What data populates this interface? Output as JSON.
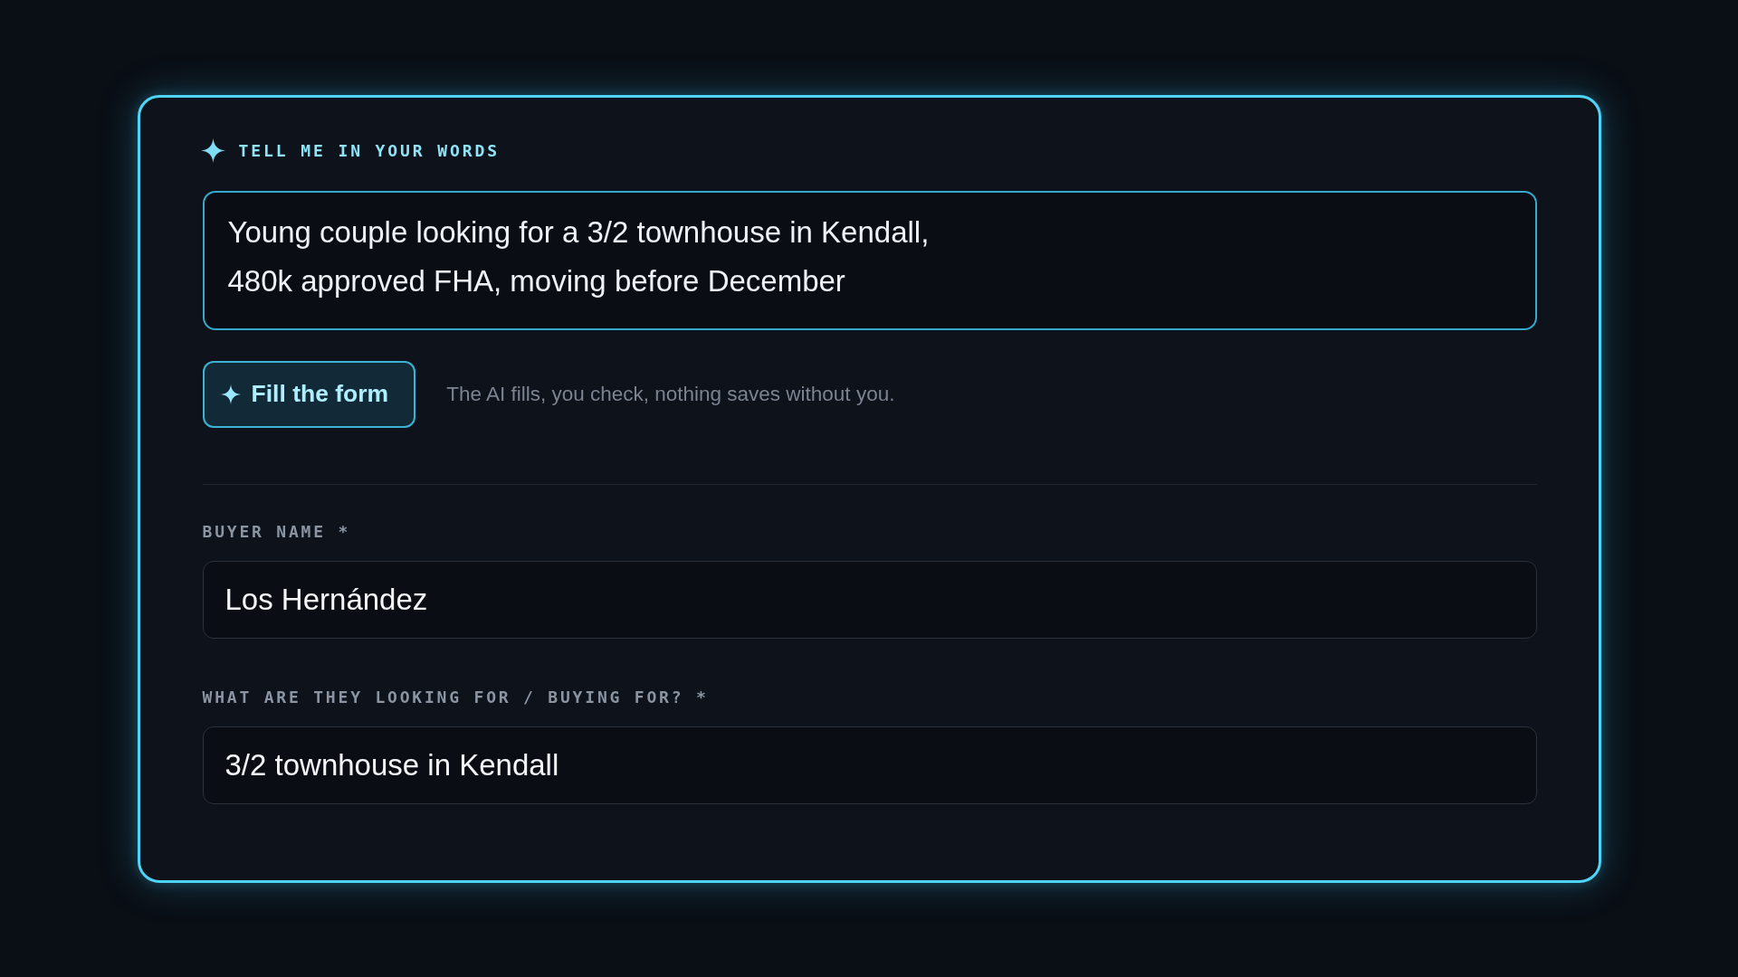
{
  "prompt": {
    "heading": "TELL ME IN YOUR WORDS",
    "value": "Young couple looking for a 3/2 townhouse in Kendall,\n480k approved FHA, moving before December",
    "button": "Fill the form",
    "hint": "The AI fills, you check, nothing saves without you."
  },
  "fields": [
    {
      "label": "BUYER NAME *",
      "value": "Los Hernández"
    },
    {
      "label": "WHAT ARE THEY LOOKING FOR / BUYING FOR? *",
      "value": "3/2 townhouse in Kendall"
    }
  ]
}
